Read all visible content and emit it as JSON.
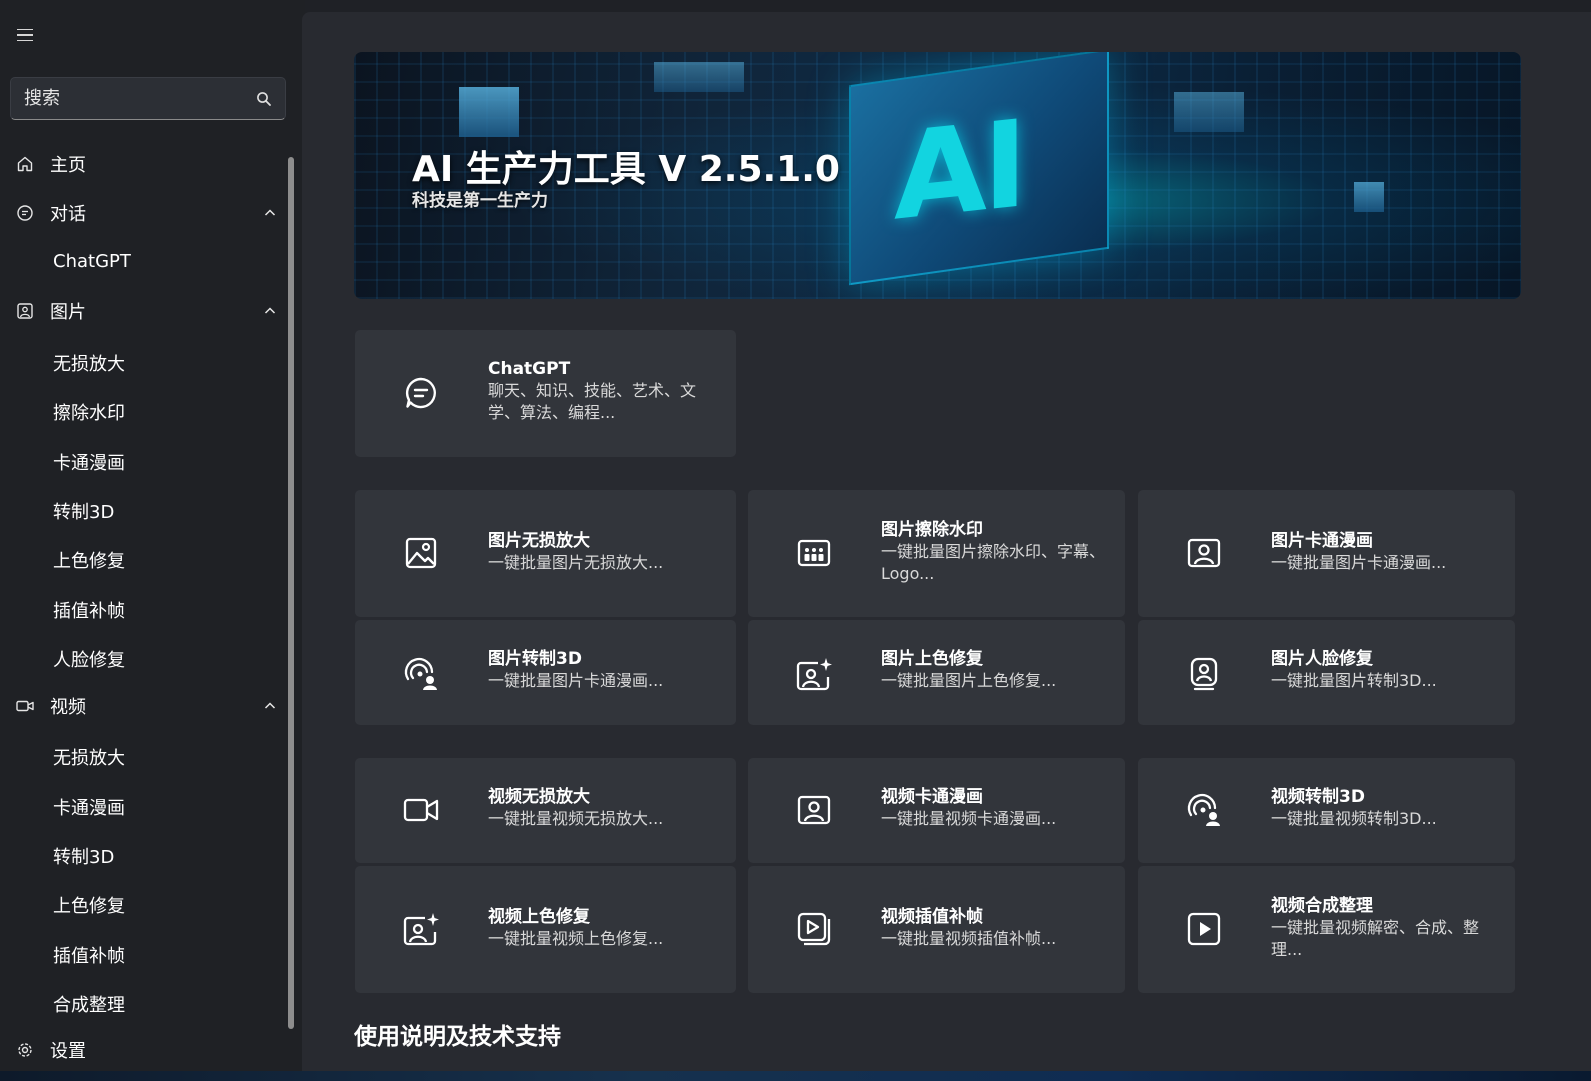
{
  "sidebar": {
    "search": {
      "placeholder": "搜索"
    },
    "nav": [
      {
        "label": "主页"
      },
      {
        "label": "对话",
        "children": [
          "ChatGPT"
        ]
      },
      {
        "label": "图片",
        "children": [
          "无损放大",
          "擦除水印",
          "卡通漫画",
          "转制3D",
          "上色修复",
          "插值补帧",
          "人脸修复"
        ]
      },
      {
        "label": "视频",
        "children": [
          "无损放大",
          "卡通漫画",
          "转制3D",
          "上色修复",
          "插值补帧",
          "合成整理"
        ]
      }
    ],
    "settings_label": "设置"
  },
  "banner": {
    "title": "AI 生产力工具 V 2.5.1.0",
    "subtitle": "科技是第一生产力",
    "graphic_text": "AI"
  },
  "cards": {
    "chat": {
      "title": "ChatGPT",
      "desc": "聊天、知识、技能、艺术、文学、算法、编程..."
    },
    "image": [
      {
        "title": "图片无损放大",
        "desc": "一键批量图片无损放大..."
      },
      {
        "title": "图片擦除水印",
        "desc": "一键批量图片擦除水印、字幕、Logo..."
      },
      {
        "title": "图片卡通漫画",
        "desc": "一键批量图片卡通漫画..."
      },
      {
        "title": "图片转制3D",
        "desc": "一键批量图片卡通漫画..."
      },
      {
        "title": "图片上色修复",
        "desc": "一键批量图片上色修复..."
      },
      {
        "title": "图片人脸修复",
        "desc": "一键批量图片转制3D..."
      }
    ],
    "video": [
      {
        "title": "视频无损放大",
        "desc": "一键批量视频无损放大..."
      },
      {
        "title": "视频卡通漫画",
        "desc": "一键批量视频卡通漫画..."
      },
      {
        "title": "视频转制3D",
        "desc": "一键批量视频转制3D..."
      },
      {
        "title": "视频上色修复",
        "desc": "一键批量视频上色修复..."
      },
      {
        "title": "视频插值补帧",
        "desc": "一键批量视频插值补帧..."
      },
      {
        "title": "视频合成整理",
        "desc": "一键批量视频解密、合成、整理..."
      }
    ]
  },
  "section": {
    "title": "使用说明及技术支持"
  },
  "colors": {
    "sidebar_bg": "#1f2125",
    "main_bg": "#282a30",
    "card_bg": "#32353b",
    "accent": "#12d4e0"
  }
}
